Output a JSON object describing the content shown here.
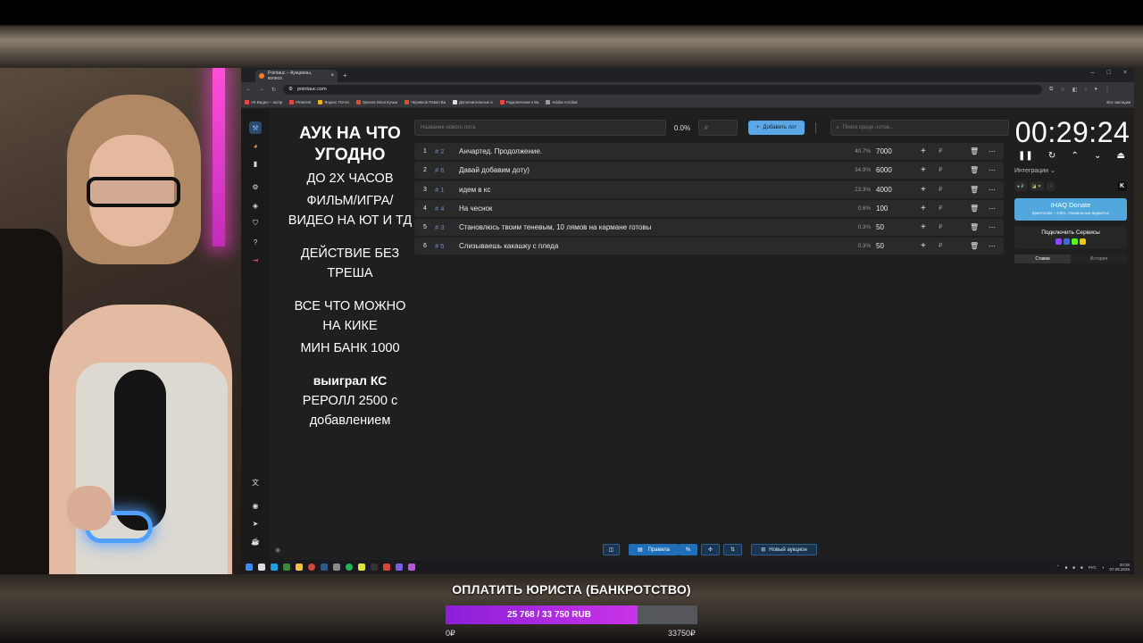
{
  "browser": {
    "tab_title": "Pointauc – Аукционы, колесо",
    "url": "pointauc.com",
    "bookmarks": [
      "VK Видео – экспр",
      "Pinterest",
      "Яндекс Почта",
      "Орехов Илья Кузьм",
      "Черняков Павел Ва",
      "Дополнительные и",
      "Подключение к Ва",
      "Adobe Acrobat"
    ],
    "bookmarks_right": "Все закладки"
  },
  "rules": {
    "title": "АУК НА ЧТО УГОДНО",
    "title_line1": "АУК НА ЧТО",
    "title_line2": "УГОДНО",
    "line1": "ДО 2Х ЧАСОВ",
    "line2": "ФИЛЬМ/ИГРА/",
    "line3": "ВИДЕО НА ЮТ И ТД",
    "line4": "ДЕЙСТВИЕ БЕЗ",
    "line5": "ТРЕША",
    "line6": "ВСЕ ЧТО МОЖНО",
    "line7": "НА КИКЕ",
    "line8": "МИН БАНК 1000",
    "line9": "выиграл КС",
    "line10": "РЕРОЛЛ 2500 с",
    "line11": "добавлением"
  },
  "controls": {
    "lot_name_placeholder": "Название нового лота",
    "percent": "0.0%",
    "amount_placeholder": "₽",
    "add_button": "Добавить лот",
    "search_placeholder": "Поиск среди лотов..."
  },
  "lots": [
    {
      "idx": "1",
      "id": "# 2",
      "name": "Анчартед. Продолжение.",
      "pct": "40.7%",
      "amount": "7000"
    },
    {
      "idx": "2",
      "id": "# 6",
      "name": "Давай добавим доту)",
      "pct": "34.9%",
      "amount": "6000"
    },
    {
      "idx": "3",
      "id": "# 1",
      "name": "идем в кс",
      "pct": "23.3%",
      "amount": "4000"
    },
    {
      "idx": "4",
      "id": "# 4",
      "name": "На чеснок",
      "pct": "0.6%",
      "amount": "100"
    },
    {
      "idx": "5",
      "id": "# 3",
      "name": "Становлюсь твоим теневым, 10 лямов на кармане готовы",
      "pct": "0.3%",
      "amount": "50"
    },
    {
      "idx": "6",
      "id": "# 5",
      "name": "Слизываешь какашку с пледа",
      "pct": "0.3%",
      "amount": "50"
    }
  ],
  "timer": {
    "value": "00:29:24"
  },
  "integrations": {
    "label": "Интеграции",
    "donate_title": "IHAQ Donate",
    "donate_sub": "Криптосим – 3,5%. Уникальные виджеты!",
    "connect_title": "Подключить Сервисы",
    "tab_bids": "Ставки",
    "tab_history": "История"
  },
  "bottom": {
    "rules_button": "Правила",
    "percent_button": "%",
    "new_auction_button": "Новый аукцион"
  },
  "taskbar": {
    "lang": "РУС",
    "time": "20:36",
    "date": "07.08.2026"
  },
  "goal": {
    "title": "ОПЛАТИТЬ ЮРИСТА (БАНКРОТСТВО)",
    "amount_text": "25 768 / 33 750 RUB",
    "current": 25768,
    "target": 33750,
    "min_label": "0₽",
    "max_label": "33750₽"
  },
  "colors": {
    "accent": "#5aa7e8",
    "goal_fill": "#b02ee0",
    "neon": "#ff4fd8"
  }
}
